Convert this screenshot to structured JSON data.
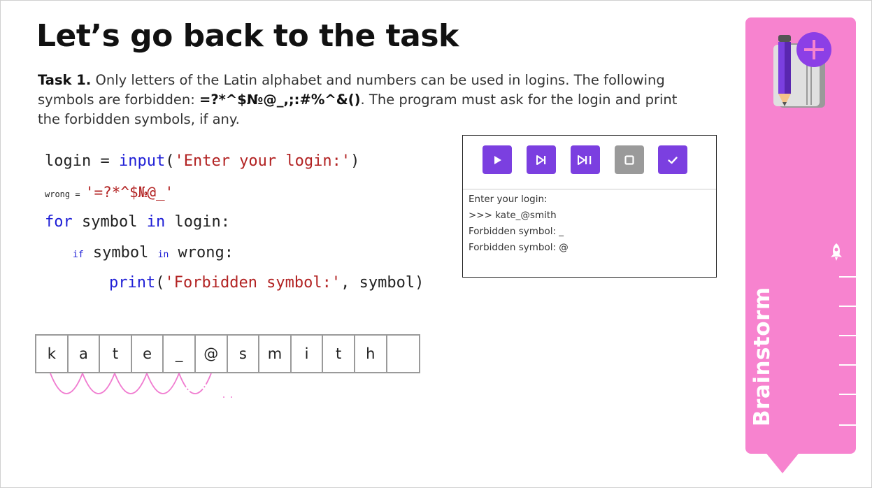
{
  "slide": {
    "title": "Let’s go back to the task",
    "task": {
      "label": "Task 1.",
      "text_1": " Only letters of the Latin alphabet and numbers can be used in logins. The following symbols are forbidden: ",
      "symbols": "=?*^$№@_,;:#%^&()",
      "text_2": ". The program must ask for the login and print the forbidden symbols, if any."
    }
  },
  "code": {
    "line1": {
      "var": "login",
      "op": " = ",
      "func": "input",
      "open": "(",
      "str": "'Enter your login:'",
      "close": ")"
    },
    "line2": {
      "var": "wrong",
      "op": " = ",
      "str": "'=?*^$№@_'"
    },
    "line3": {
      "kw_for": "for",
      "var": " symbol ",
      "kw_in": "in",
      "rest": " login:"
    },
    "line4": {
      "kw_if": "if",
      "var": " symbol ",
      "kw_in": "in",
      "rest": " wrong:"
    },
    "line5": {
      "func": "print",
      "open": "(",
      "str": "'Forbidden symbol:'",
      "sep": ", symbol",
      "close": ")"
    }
  },
  "console": {
    "buttons": [
      {
        "name": "run",
        "icon": "play-icon"
      },
      {
        "name": "step",
        "icon": "step-over-icon"
      },
      {
        "name": "step-into",
        "icon": "step-into-icon"
      },
      {
        "name": "stop",
        "icon": "stop-icon"
      },
      {
        "name": "check",
        "icon": "check-icon"
      }
    ],
    "output": [
      "Enter your login:",
      ">>> kate_@smith",
      "Forbidden symbol: _",
      "Forbidden symbol: @"
    ]
  },
  "cells": [
    "k",
    "a",
    "t",
    "e",
    "_",
    "@",
    "s",
    "m",
    "i",
    "t",
    "h",
    ""
  ],
  "panel": {
    "label": "Brainstorm",
    "icons": [
      "notebook-pencil-icon",
      "rocket-icon"
    ],
    "color": "#f783cf"
  },
  "colors": {
    "accent": "#7b3fe0",
    "keyword": "#1f1fd6",
    "string": "#b22222",
    "arc": "#f07bd0"
  }
}
